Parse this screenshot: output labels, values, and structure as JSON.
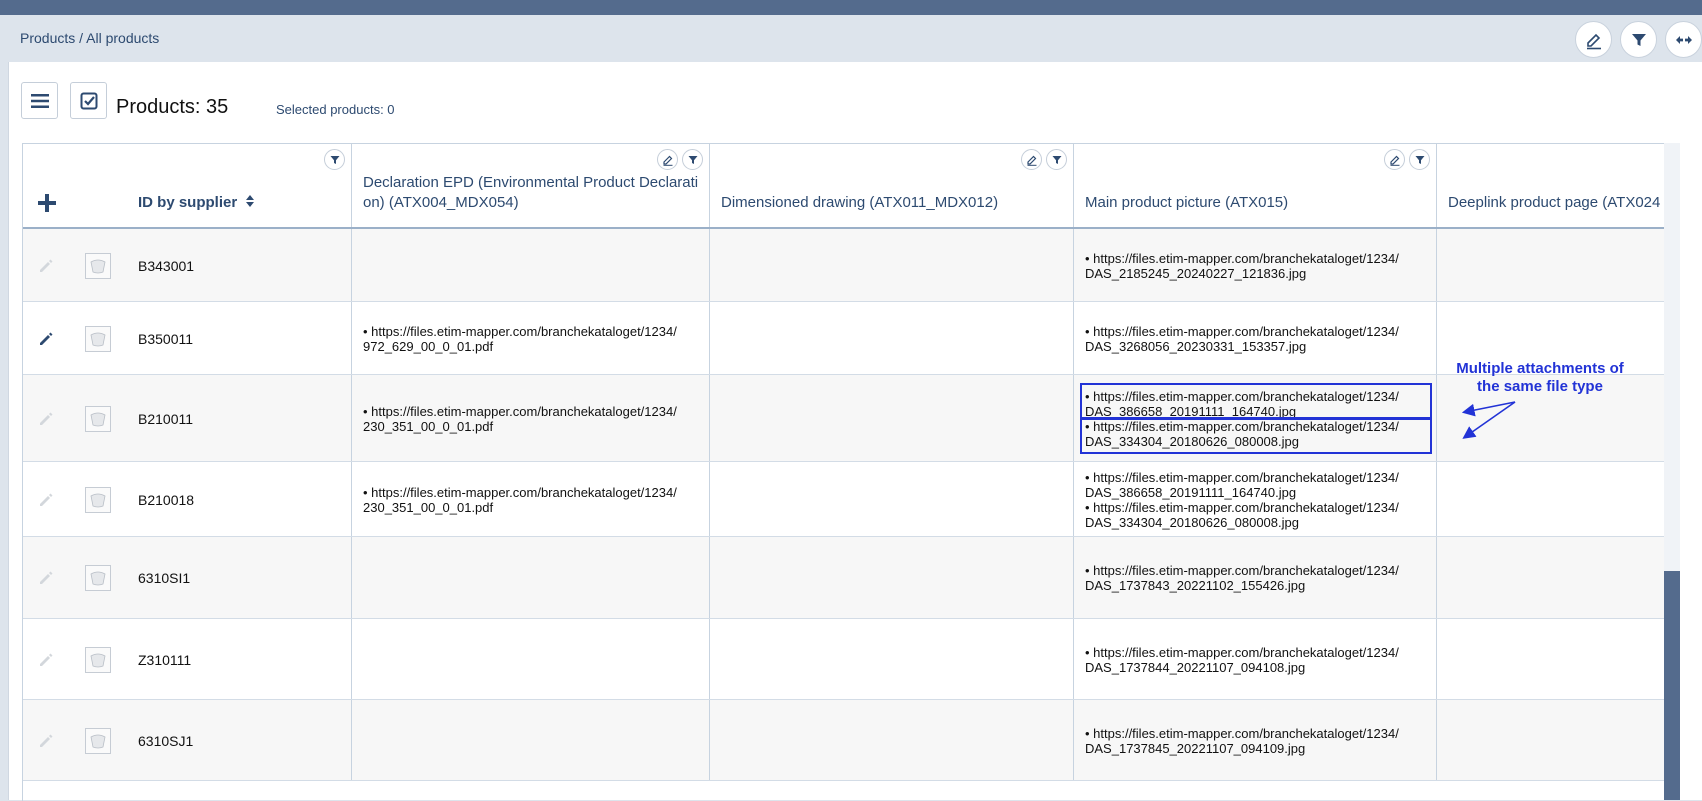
{
  "breadcrumb": {
    "root": "Products",
    "separator": " / ",
    "current": "All products"
  },
  "toolbar": {
    "products_count": "Products: 35",
    "selected_products": "Selected products: 0"
  },
  "columns": {
    "add_icon": "plus-icon",
    "id": "ID by supplier",
    "epd": "Declaration EPD (Environmental Product Declarati",
    "epd_line2": "on) (ATX004_MDX054)",
    "drawing": "Dimensioned drawing (ATX011_MDX012)",
    "picture": "Main product picture (ATX015)",
    "deeplink": "Deeplink product page (ATX024"
  },
  "rows": [
    {
      "id": "B343001",
      "epd": [],
      "picture": [
        "• https://files.etim-mapper.com/branchekataloget/1234/",
        "DAS_2185245_20240227_121836.jpg"
      ]
    },
    {
      "id": "B350011",
      "epd": [
        "• https://files.etim-mapper.com/branchekataloget/1234/",
        "972_629_00_0_01.pdf"
      ],
      "picture": [
        "• https://files.etim-mapper.com/branchekataloget/1234/",
        "DAS_3268056_20230331_153357.jpg"
      ]
    },
    {
      "id": "B210011",
      "epd": [
        "• https://files.etim-mapper.com/branchekataloget/1234/",
        "230_351_00_0_01.pdf"
      ],
      "picture": [
        "• https://files.etim-mapper.com/branchekataloget/1234/",
        "DAS_386658_20191111_164740.jpg",
        "• https://files.etim-mapper.com/branchekataloget/1234/",
        "DAS_334304_20180626_080008.jpg"
      ]
    },
    {
      "id": "B210018",
      "epd": [
        "• https://files.etim-mapper.com/branchekataloget/1234/",
        "230_351_00_0_01.pdf"
      ],
      "picture": [
        "• https://files.etim-mapper.com/branchekataloget/1234/",
        "DAS_386658_20191111_164740.jpg",
        "• https://files.etim-mapper.com/branchekataloget/1234/",
        "DAS_334304_20180626_080008.jpg"
      ]
    },
    {
      "id": "6310SI1",
      "epd": [],
      "picture": [
        "• https://files.etim-mapper.com/branchekataloget/1234/",
        "DAS_1737843_20221102_155426.jpg"
      ]
    },
    {
      "id": "Z310111",
      "epd": [],
      "picture": [
        "• https://files.etim-mapper.com/branchekataloget/1234/",
        "DAS_1737844_20221107_094108.jpg"
      ]
    },
    {
      "id": "6310SJ1",
      "epd": [],
      "picture": [
        "• https://files.etim-mapper.com/branchekataloget/1234/",
        "DAS_1737845_20221107_094109.jpg"
      ]
    }
  ],
  "annotation": {
    "line1": "Multiple attachments of",
    "line2": "the same file type",
    "color": "#2233d6"
  },
  "colors": {
    "topbar": "#546b8d",
    "header_text": "#2d4a70",
    "accent": "#2d4a70"
  }
}
